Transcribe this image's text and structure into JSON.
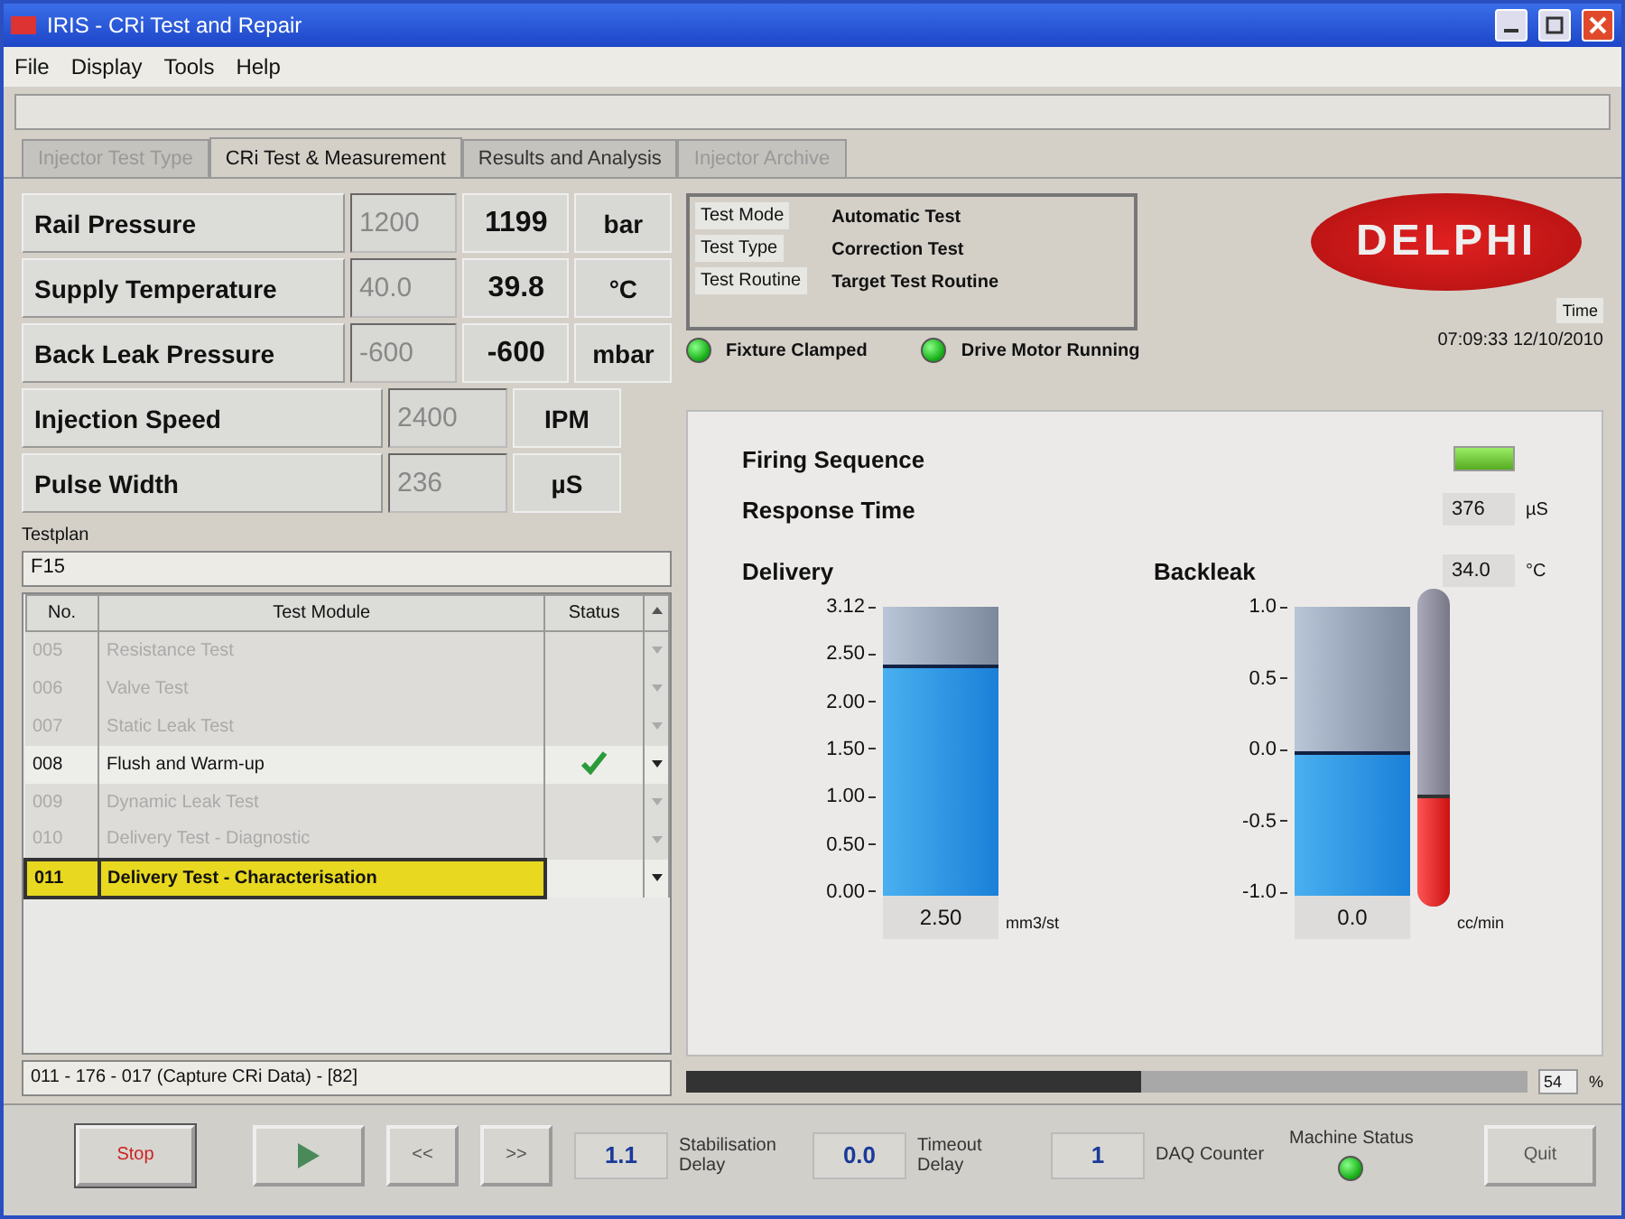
{
  "window": {
    "title": "IRIS - CRi Test and Repair"
  },
  "menu": [
    "File",
    "Display",
    "Tools",
    "Help"
  ],
  "tabs": [
    {
      "label": "Injector Test Type",
      "selected": false,
      "disabled": true
    },
    {
      "label": "CRi Test & Measurement",
      "selected": true,
      "disabled": false
    },
    {
      "label": "Results and Analysis",
      "selected": false,
      "disabled": false
    },
    {
      "label": "Injector Archive",
      "selected": false,
      "disabled": true
    }
  ],
  "measurements": [
    {
      "label": "Rail Pressure",
      "setpoint": "1200",
      "actual": "1199",
      "unit": "bar"
    },
    {
      "label": "Supply Temperature",
      "setpoint": "40.0",
      "actual": "39.8",
      "unit": "°C"
    },
    {
      "label": "Back Leak Pressure",
      "setpoint": "-600",
      "actual": "-600",
      "unit": "mbar"
    },
    {
      "label": "Injection Speed",
      "setpoint": "2400",
      "unit": "IPM"
    },
    {
      "label": "Pulse Width",
      "setpoint": "236",
      "unit": "µS"
    }
  ],
  "testplan": {
    "label": "Testplan",
    "name": "F15",
    "columns": [
      "No.",
      "Test Module",
      "Status"
    ],
    "rows": [
      {
        "no": "005",
        "module": "Resistance Test",
        "disabled": true,
        "selected": false,
        "checked": false
      },
      {
        "no": "006",
        "module": "Valve Test",
        "disabled": true,
        "selected": false,
        "checked": false
      },
      {
        "no": "007",
        "module": "Static Leak Test",
        "disabled": true,
        "selected": false,
        "checked": false
      },
      {
        "no": "008",
        "module": "Flush and Warm-up",
        "disabled": false,
        "selected": false,
        "checked": true
      },
      {
        "no": "009",
        "module": "Dynamic Leak Test",
        "disabled": true,
        "selected": false,
        "checked": false
      },
      {
        "no": "010",
        "module": "Delivery Test - Diagnostic",
        "disabled": true,
        "selected": false,
        "checked": false
      },
      {
        "no": "011",
        "module": "Delivery Test - Characterisation",
        "disabled": false,
        "selected": true,
        "checked": false
      }
    ],
    "footer": "011 - 176 - 017 (Capture CRi Data) - [82]"
  },
  "test_info": [
    {
      "label": "Test Mode",
      "value": "Automatic Test"
    },
    {
      "label": "Test Type",
      "value": "Correction Test"
    },
    {
      "label": "Test Routine",
      "value": "Target Test Routine"
    }
  ],
  "logo": "DELPHI",
  "time": {
    "label": "Time",
    "value": "07:09:33  12/10/2010"
  },
  "indicators": [
    {
      "label": "Fixture Clamped",
      "on": true
    },
    {
      "label": "Drive Motor Running",
      "on": true
    }
  ],
  "firing_sequence": {
    "label": "Firing Sequence",
    "on": true
  },
  "response_time": {
    "label": "Response Time",
    "value": "376",
    "unit": "µS"
  },
  "delivery": {
    "label": "Delivery",
    "ticks": [
      "3.12",
      "2.50",
      "2.00",
      "1.50",
      "1.00",
      "0.50",
      "0.00"
    ],
    "level": 0.8,
    "reading": "2.50",
    "unit": "mm3/st"
  },
  "backleak": {
    "label": "Backleak",
    "temperature": "34.0",
    "temperature_unit": "°C",
    "ticks": [
      "1.0",
      "0.5",
      "0.0",
      "-0.5",
      "-1.0"
    ],
    "level": 0.5,
    "reading": "0.0",
    "unit": "cc/min",
    "thermometer": {
      "level": 0.35
    }
  },
  "progress": {
    "level": 0.54,
    "reading": "54",
    "unit": "%"
  },
  "controls": {
    "buttons": [
      {
        "kind": "stop",
        "label": "Stop"
      },
      {
        "kind": "play"
      },
      {
        "kind": "text",
        "label": "<<"
      },
      {
        "kind": "text",
        "label": ">>"
      }
    ],
    "readouts": [
      {
        "value": "1.1",
        "label": "Stabilisation Delay"
      },
      {
        "value": "0.0",
        "label": "Timeout Delay"
      },
      {
        "value": "1",
        "label": "DAQ Counter"
      }
    ],
    "machine_status": {
      "label": "Machine Status",
      "on": true
    },
    "quit": "Quit"
  }
}
